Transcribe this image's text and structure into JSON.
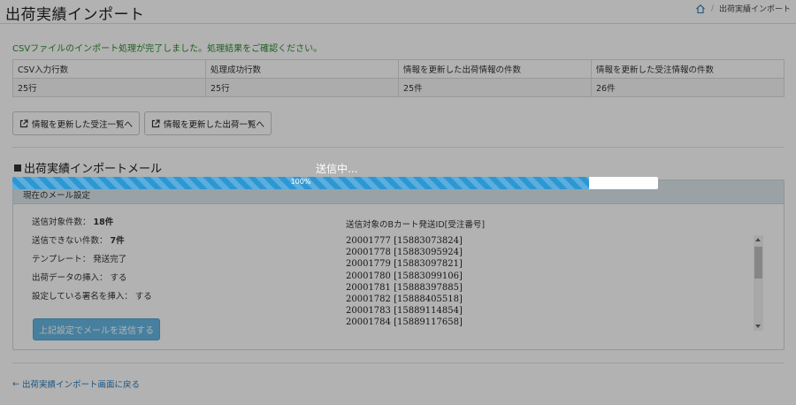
{
  "header": {
    "title": "出荷実績インポート",
    "breadcrumb_icon": "home-icon",
    "breadcrumb_current": "出荷実績インポート"
  },
  "result": {
    "message": "CSVファイルのインポート処理が完了しました。処理結果をご確認ください。",
    "columns": [
      "CSV入力行数",
      "処理成功行数",
      "情報を更新した出荷情報の件数",
      "情報を更新した受注情報の件数"
    ],
    "values": [
      "25行",
      "25行",
      "25件",
      "26件"
    ]
  },
  "actions": {
    "updated_orders_label": "情報を更新した受注一覧へ",
    "updated_shipments_label": "情報を更新した出荷一覧へ"
  },
  "mail": {
    "heading": "出荷実績インポートメール",
    "panel_title": "現在のメール設定",
    "target_count_label": "送信対象件数：",
    "target_count_value": "18件",
    "unsendable_label": "送信できない件数：",
    "unsendable_value": "7件",
    "template_label": "テンプレート：",
    "template_value": "発送完了",
    "shipping_data_label": "出荷データの挿入：",
    "shipping_data_value": "する",
    "signature_label": "設定している署名を挿入：",
    "signature_value": "する",
    "send_button_label": "上記設定でメールを送信する",
    "id_list_title": "送信対象のBカート発送ID[受注番号]",
    "ids": [
      "20001777 [15883073824]",
      "20001778 [15883095924]",
      "20001779 [15883097821]",
      "20001780 [15883099106]",
      "20001781 [15888397885]",
      "20001782 [15888405518]",
      "20001783 [15889114854]",
      "20001784 [15889117658]"
    ]
  },
  "footer": {
    "back_link_label": "出荷実績インポート画面に戻る"
  },
  "modal": {
    "sending_text": "送信中...",
    "progress_percent": 89.3,
    "progress_label": "100%"
  },
  "colors": {
    "accent": "#2d97d4",
    "success_text": "#2f8a2f",
    "link": "#2a7ab8"
  }
}
